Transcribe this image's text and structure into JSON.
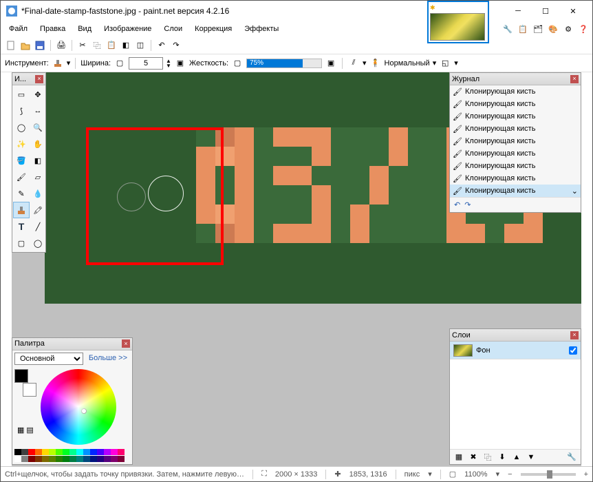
{
  "window": {
    "title": "*Final-date-stamp-faststone.jpg - paint.net версия 4.2.16"
  },
  "menu": {
    "file": "Файл",
    "edit": "Правка",
    "view": "Вид",
    "image": "Изображение",
    "layers": "Слои",
    "adjust": "Коррекция",
    "effects": "Эффекты"
  },
  "options": {
    "tool_label": "Инструмент:",
    "width_label": "Ширина:",
    "width_value": "5",
    "hardness_label": "Жесткость:",
    "hardness_value": "75%",
    "blend_label": "Нормальный"
  },
  "tools_panel_title": "И...",
  "history": {
    "title": "Журнал",
    "item": "Клонирующая кисть"
  },
  "palette": {
    "title": "Палитра",
    "primary": "Основной",
    "more": "Больше >>"
  },
  "layers": {
    "title": "Слои",
    "bg": "Фон"
  },
  "status": {
    "hint": "Ctrl+щелчок, чтобы задать точку привязки. Затем, нажмите левую кнопку мыши и тяните для копирования изображения вокруг точк...",
    "size": "2000 × 1333",
    "unit": "пикс",
    "pos": "1853, 1316",
    "zoom": "1100%"
  }
}
